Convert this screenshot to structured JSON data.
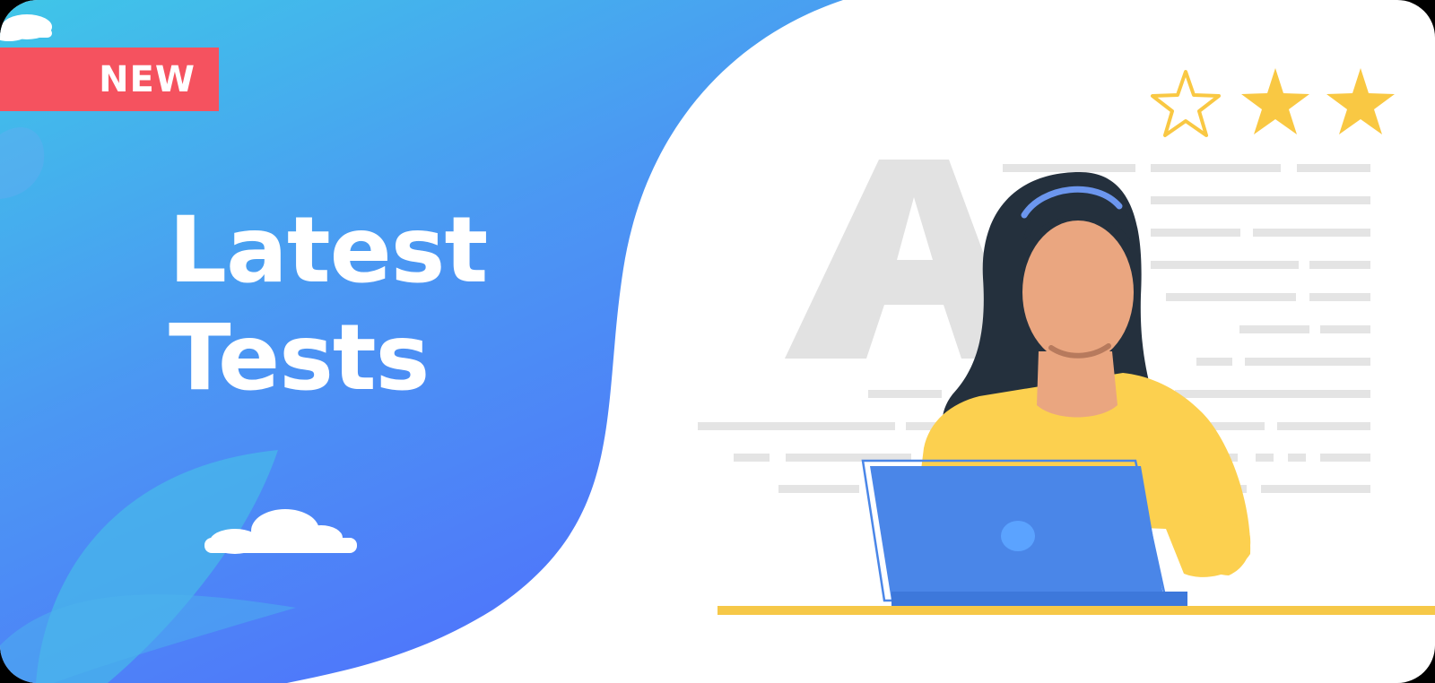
{
  "badge": {
    "label": "NEW",
    "color": "#f5525f"
  },
  "headline": {
    "line1": "Latest",
    "line2": "Tests"
  },
  "rating": {
    "stars_total": 3,
    "stars_filled": 2,
    "star_color": "#f9c843"
  },
  "colors": {
    "gradient_start": "#3fc6e8",
    "gradient_end": "#4f74fb",
    "hair": "#24303d",
    "skin": "#eaa680",
    "shirt": "#fcd04f",
    "laptop": "#4a86e8",
    "desk": "#f6c848",
    "lines": "#e4e4e4"
  },
  "icons": {
    "cloud_large": "cloud-icon",
    "cloud_corner": "cloud-icon",
    "letter_a": "letter-a-icon",
    "person": "woman-at-laptop-icon"
  }
}
